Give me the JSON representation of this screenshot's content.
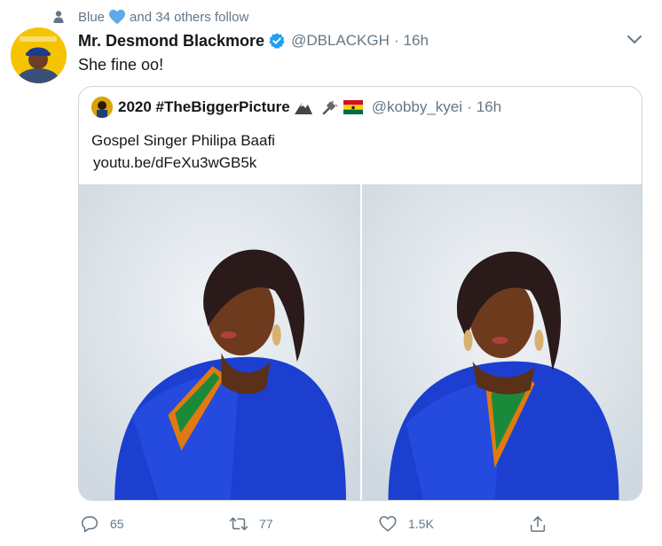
{
  "social_context": {
    "name": "Blue",
    "suffix": "and 34 others follow"
  },
  "tweet": {
    "display_name": "Mr. Desmond Blackmore",
    "handle": "@DBLACKGH",
    "separator": "·",
    "time": "16h",
    "text": "She fine oo!",
    "quote": {
      "name": "2020 #TheBiggerPicture",
      "handle": "@kobby_kyei",
      "separator": "·",
      "time": "16h",
      "text": "Gospel Singer Philipa Baafi",
      "link": "youtu.be/dFeXu3wGB5k"
    },
    "actions": {
      "replies": "65",
      "retweets": "77",
      "likes": "1.5K"
    }
  },
  "colors": {
    "accent": "#1da1f2",
    "secondary_text": "#657786",
    "border": "#ccd6dd",
    "dress": "#1c3fd0"
  },
  "icons": [
    "person-icon",
    "heart-icon",
    "verified-icon",
    "chevron-down-icon",
    "reply-icon",
    "retweet-icon",
    "like-icon",
    "share-icon"
  ]
}
